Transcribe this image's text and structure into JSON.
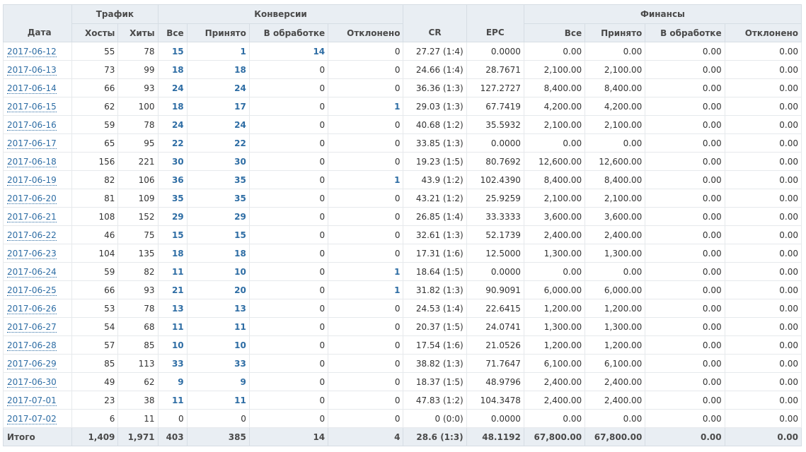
{
  "headers": {
    "group_traffic": "Трафик",
    "group_conversions": "Конверсии",
    "group_finance": "Финансы",
    "date": "Дата",
    "hosts": "Хосты",
    "hits": "Хиты",
    "conv_all": "Все",
    "conv_accepted": "Принято",
    "conv_pending": "В обработке",
    "conv_rejected": "Отклонено",
    "cr": "CR",
    "epc": "EPC",
    "fin_all": "Все",
    "fin_accepted": "Принято",
    "fin_pending": "В обработке",
    "fin_rejected": "Отклонено"
  },
  "rows": [
    {
      "date": "2017-06-12",
      "hosts": "55",
      "hits": "78",
      "all": "15",
      "accepted": "1",
      "pending": "14",
      "rejected": "0",
      "cr": "27.27 (1:4)",
      "epc": "0.0000",
      "f_all": "0.00",
      "f_accepted": "0.00",
      "f_pending": "0.00",
      "f_rejected": "0.00"
    },
    {
      "date": "2017-06-13",
      "hosts": "73",
      "hits": "99",
      "all": "18",
      "accepted": "18",
      "pending": "0",
      "rejected": "0",
      "cr": "24.66 (1:4)",
      "epc": "28.7671",
      "f_all": "2,100.00",
      "f_accepted": "2,100.00",
      "f_pending": "0.00",
      "f_rejected": "0.00"
    },
    {
      "date": "2017-06-14",
      "hosts": "66",
      "hits": "93",
      "all": "24",
      "accepted": "24",
      "pending": "0",
      "rejected": "0",
      "cr": "36.36 (1:3)",
      "epc": "127.2727",
      "f_all": "8,400.00",
      "f_accepted": "8,400.00",
      "f_pending": "0.00",
      "f_rejected": "0.00"
    },
    {
      "date": "2017-06-15",
      "hosts": "62",
      "hits": "100",
      "all": "18",
      "accepted": "17",
      "pending": "0",
      "rejected": "1",
      "cr": "29.03 (1:3)",
      "epc": "67.7419",
      "f_all": "4,200.00",
      "f_accepted": "4,200.00",
      "f_pending": "0.00",
      "f_rejected": "0.00"
    },
    {
      "date": "2017-06-16",
      "hosts": "59",
      "hits": "78",
      "all": "24",
      "accepted": "24",
      "pending": "0",
      "rejected": "0",
      "cr": "40.68 (1:2)",
      "epc": "35.5932",
      "f_all": "2,100.00",
      "f_accepted": "2,100.00",
      "f_pending": "0.00",
      "f_rejected": "0.00"
    },
    {
      "date": "2017-06-17",
      "hosts": "65",
      "hits": "95",
      "all": "22",
      "accepted": "22",
      "pending": "0",
      "rejected": "0",
      "cr": "33.85 (1:3)",
      "epc": "0.0000",
      "f_all": "0.00",
      "f_accepted": "0.00",
      "f_pending": "0.00",
      "f_rejected": "0.00"
    },
    {
      "date": "2017-06-18",
      "hosts": "156",
      "hits": "221",
      "all": "30",
      "accepted": "30",
      "pending": "0",
      "rejected": "0",
      "cr": "19.23 (1:5)",
      "epc": "80.7692",
      "f_all": "12,600.00",
      "f_accepted": "12,600.00",
      "f_pending": "0.00",
      "f_rejected": "0.00"
    },
    {
      "date": "2017-06-19",
      "hosts": "82",
      "hits": "106",
      "all": "36",
      "accepted": "35",
      "pending": "0",
      "rejected": "1",
      "cr": "43.9 (1:2)",
      "epc": "102.4390",
      "f_all": "8,400.00",
      "f_accepted": "8,400.00",
      "f_pending": "0.00",
      "f_rejected": "0.00"
    },
    {
      "date": "2017-06-20",
      "hosts": "81",
      "hits": "109",
      "all": "35",
      "accepted": "35",
      "pending": "0",
      "rejected": "0",
      "cr": "43.21 (1:2)",
      "epc": "25.9259",
      "f_all": "2,100.00",
      "f_accepted": "2,100.00",
      "f_pending": "0.00",
      "f_rejected": "0.00"
    },
    {
      "date": "2017-06-21",
      "hosts": "108",
      "hits": "152",
      "all": "29",
      "accepted": "29",
      "pending": "0",
      "rejected": "0",
      "cr": "26.85 (1:4)",
      "epc": "33.3333",
      "f_all": "3,600.00",
      "f_accepted": "3,600.00",
      "f_pending": "0.00",
      "f_rejected": "0.00"
    },
    {
      "date": "2017-06-22",
      "hosts": "46",
      "hits": "75",
      "all": "15",
      "accepted": "15",
      "pending": "0",
      "rejected": "0",
      "cr": "32.61 (1:3)",
      "epc": "52.1739",
      "f_all": "2,400.00",
      "f_accepted": "2,400.00",
      "f_pending": "0.00",
      "f_rejected": "0.00"
    },
    {
      "date": "2017-06-23",
      "hosts": "104",
      "hits": "135",
      "all": "18",
      "accepted": "18",
      "pending": "0",
      "rejected": "0",
      "cr": "17.31 (1:6)",
      "epc": "12.5000",
      "f_all": "1,300.00",
      "f_accepted": "1,300.00",
      "f_pending": "0.00",
      "f_rejected": "0.00"
    },
    {
      "date": "2017-06-24",
      "hosts": "59",
      "hits": "82",
      "all": "11",
      "accepted": "10",
      "pending": "0",
      "rejected": "1",
      "cr": "18.64 (1:5)",
      "epc": "0.0000",
      "f_all": "0.00",
      "f_accepted": "0.00",
      "f_pending": "0.00",
      "f_rejected": "0.00"
    },
    {
      "date": "2017-06-25",
      "hosts": "66",
      "hits": "93",
      "all": "21",
      "accepted": "20",
      "pending": "0",
      "rejected": "1",
      "cr": "31.82 (1:3)",
      "epc": "90.9091",
      "f_all": "6,000.00",
      "f_accepted": "6,000.00",
      "f_pending": "0.00",
      "f_rejected": "0.00"
    },
    {
      "date": "2017-06-26",
      "hosts": "53",
      "hits": "78",
      "all": "13",
      "accepted": "13",
      "pending": "0",
      "rejected": "0",
      "cr": "24.53 (1:4)",
      "epc": "22.6415",
      "f_all": "1,200.00",
      "f_accepted": "1,200.00",
      "f_pending": "0.00",
      "f_rejected": "0.00"
    },
    {
      "date": "2017-06-27",
      "hosts": "54",
      "hits": "68",
      "all": "11",
      "accepted": "11",
      "pending": "0",
      "rejected": "0",
      "cr": "20.37 (1:5)",
      "epc": "24.0741",
      "f_all": "1,300.00",
      "f_accepted": "1,300.00",
      "f_pending": "0.00",
      "f_rejected": "0.00"
    },
    {
      "date": "2017-06-28",
      "hosts": "57",
      "hits": "85",
      "all": "10",
      "accepted": "10",
      "pending": "0",
      "rejected": "0",
      "cr": "17.54 (1:6)",
      "epc": "21.0526",
      "f_all": "1,200.00",
      "f_accepted": "1,200.00",
      "f_pending": "0.00",
      "f_rejected": "0.00"
    },
    {
      "date": "2017-06-29",
      "hosts": "85",
      "hits": "113",
      "all": "33",
      "accepted": "33",
      "pending": "0",
      "rejected": "0",
      "cr": "38.82 (1:3)",
      "epc": "71.7647",
      "f_all": "6,100.00",
      "f_accepted": "6,100.00",
      "f_pending": "0.00",
      "f_rejected": "0.00"
    },
    {
      "date": "2017-06-30",
      "hosts": "49",
      "hits": "62",
      "all": "9",
      "accepted": "9",
      "pending": "0",
      "rejected": "0",
      "cr": "18.37 (1:5)",
      "epc": "48.9796",
      "f_all": "2,400.00",
      "f_accepted": "2,400.00",
      "f_pending": "0.00",
      "f_rejected": "0.00"
    },
    {
      "date": "2017-07-01",
      "hosts": "23",
      "hits": "38",
      "all": "11",
      "accepted": "11",
      "pending": "0",
      "rejected": "0",
      "cr": "47.83 (1:2)",
      "epc": "104.3478",
      "f_all": "2,400.00",
      "f_accepted": "2,400.00",
      "f_pending": "0.00",
      "f_rejected": "0.00"
    },
    {
      "date": "2017-07-02",
      "hosts": "6",
      "hits": "11",
      "all": "0",
      "accepted": "0",
      "pending": "0",
      "rejected": "0",
      "cr": "0 (0:0)",
      "epc": "0.0000",
      "f_all": "0.00",
      "f_accepted": "0.00",
      "f_pending": "0.00",
      "f_rejected": "0.00"
    }
  ],
  "total": {
    "label": "Итого",
    "hosts": "1,409",
    "hits": "1,971",
    "all": "403",
    "accepted": "385",
    "pending": "14",
    "rejected": "4",
    "cr": "28.6 (1:3)",
    "epc": "48.1192",
    "f_all": "67,800.00",
    "f_accepted": "67,800.00",
    "f_pending": "0.00",
    "f_rejected": "0.00"
  },
  "colors": {
    "header_bg": "#e9eef3",
    "link": "#2e6da4",
    "border": "#e6e9ec"
  }
}
